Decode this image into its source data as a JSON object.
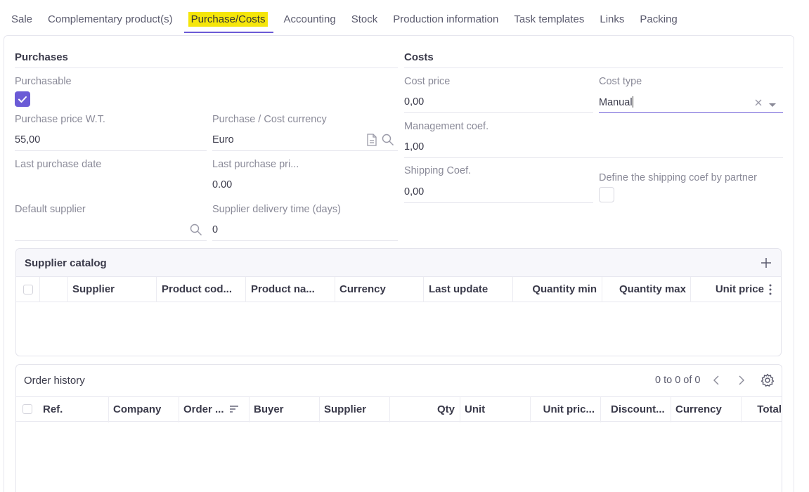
{
  "tabs": [
    {
      "label": "Sale",
      "active": false
    },
    {
      "label": "Complementary product(s)",
      "active": false
    },
    {
      "label": "Purchase/Costs",
      "active": true
    },
    {
      "label": "Accounting",
      "active": false
    },
    {
      "label": "Stock",
      "active": false
    },
    {
      "label": "Production information",
      "active": false
    },
    {
      "label": "Task templates",
      "active": false
    },
    {
      "label": "Links",
      "active": false
    },
    {
      "label": "Packing",
      "active": false
    }
  ],
  "purchases": {
    "title": "Purchases",
    "purchasable_label": "Purchasable",
    "purchasable_checked": true,
    "purchase_price_label": "Purchase price W.T.",
    "purchase_price_value": "55,00",
    "currency_label": "Purchase / Cost currency",
    "currency_value": "Euro",
    "last_purchase_date_label": "Last purchase date",
    "last_purchase_date_value": "",
    "last_purchase_price_label": "Last purchase pri...",
    "last_purchase_price_value": "0.00",
    "default_supplier_label": "Default supplier",
    "default_supplier_value": "",
    "delivery_time_label": "Supplier delivery time (days)",
    "delivery_time_value": "0"
  },
  "costs": {
    "title": "Costs",
    "cost_price_label": "Cost price",
    "cost_price_value": "0,00",
    "cost_type_label": "Cost type",
    "cost_type_value": "Manual",
    "management_coef_label": "Management coef.",
    "management_coef_value": "1,00",
    "shipping_coef_label": "Shipping Coef.",
    "shipping_coef_value": "0,00",
    "define_shipping_label": "Define the shipping coef by partner",
    "define_shipping_checked": false
  },
  "supplier_catalog": {
    "title": "Supplier catalog",
    "columns": [
      "Supplier",
      "Product cod...",
      "Product na...",
      "Currency",
      "Last update",
      "Quantity min",
      "Quantity max",
      "Unit price"
    ]
  },
  "order_history": {
    "title": "Order history",
    "pager": "0 to 0 of 0",
    "columns": [
      "Ref.",
      "Company",
      "Order ...",
      "Buyer",
      "Supplier",
      "Qty",
      "Unit",
      "Unit pric...",
      "Discount...",
      "Currency",
      "Total"
    ]
  },
  "colors": {
    "accent": "#6b5bd6",
    "tab_highlight": "#f5e60a"
  }
}
